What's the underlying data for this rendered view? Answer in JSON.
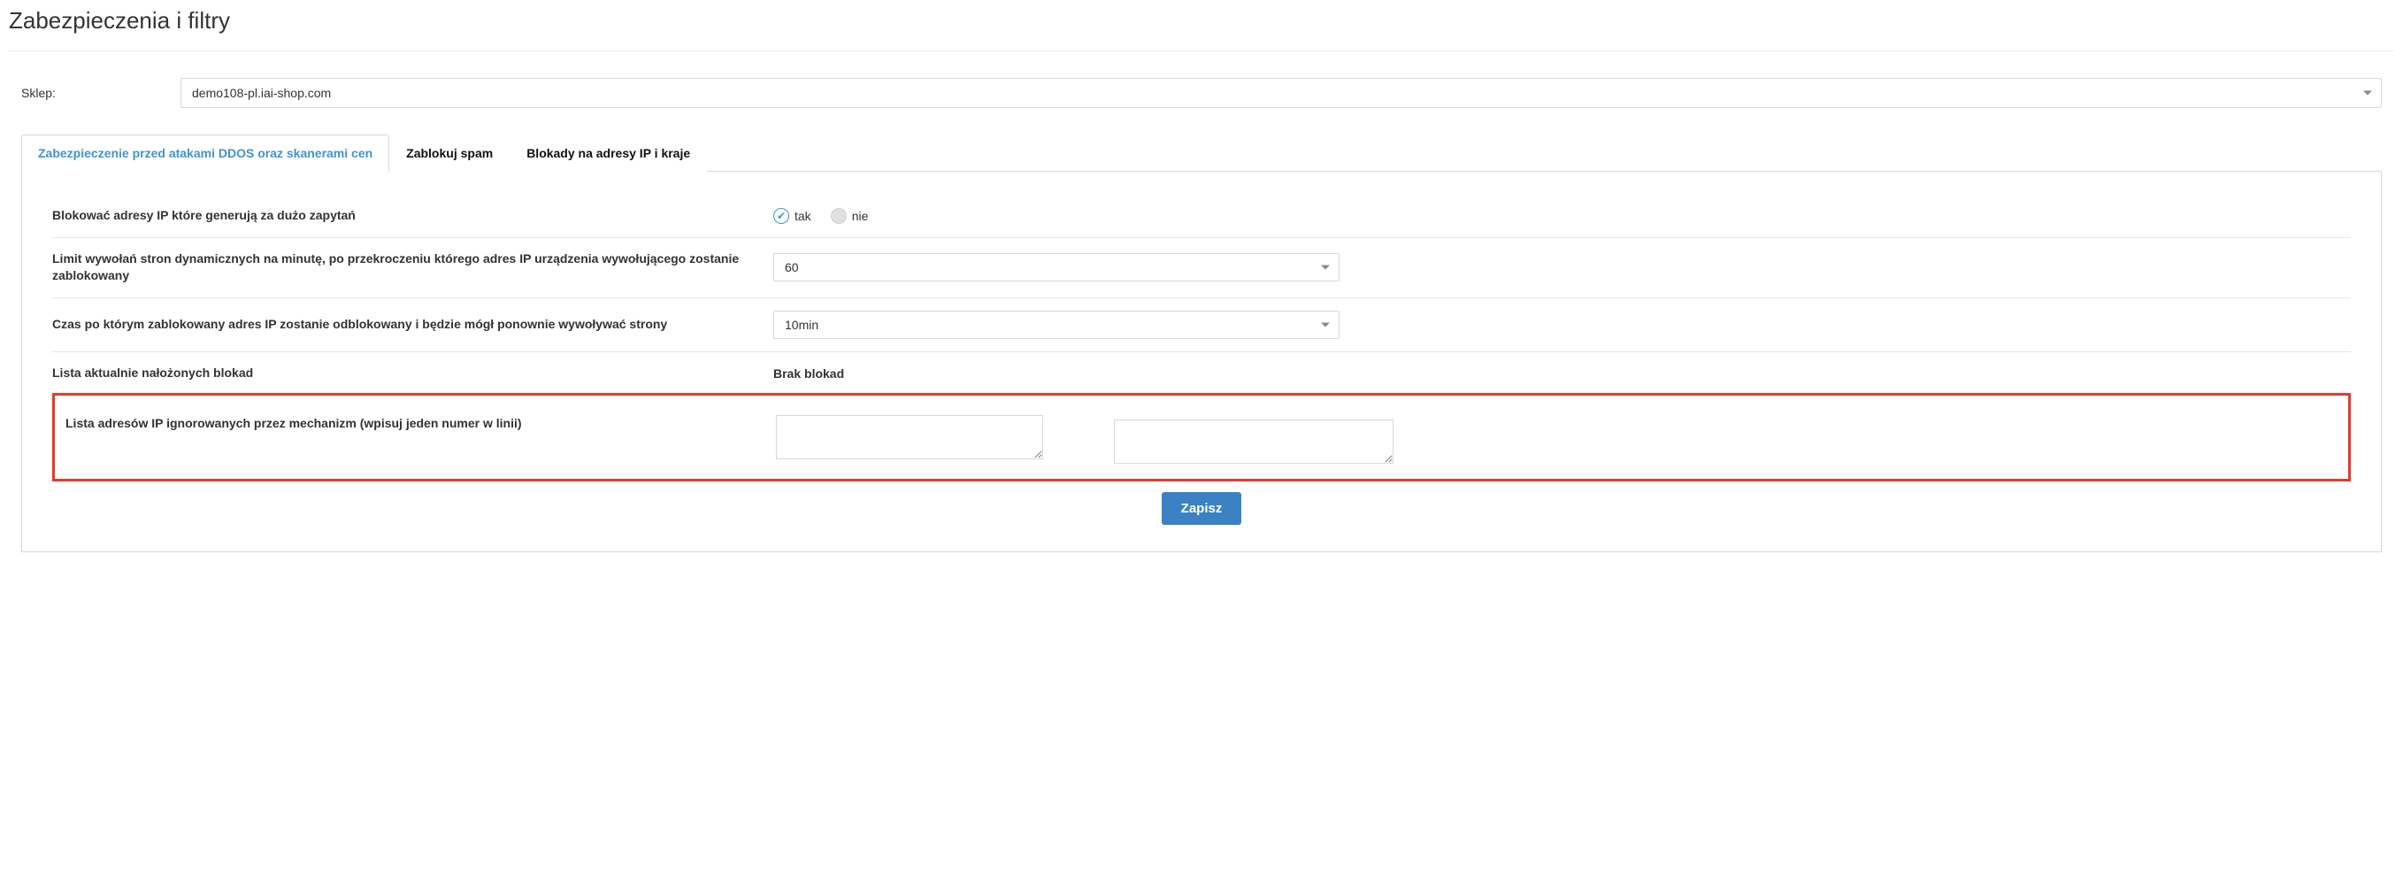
{
  "page": {
    "title": "Zabezpieczenia i filtry"
  },
  "shop": {
    "label": "Sklep:",
    "selected": "demo108-pl.iai-shop.com"
  },
  "tabs": {
    "ddos": "Zabezpieczenie przed atakami DDOS oraz skanerami cen",
    "spam": "Zablokuj spam",
    "ipblock": "Blokady na adresy IP i kraje"
  },
  "rows": {
    "block_ips": {
      "label": "Blokować adresy IP które generują za dużo zapytań",
      "yes": "tak",
      "no": "nie"
    },
    "limit": {
      "label": "Limit wywołań stron dynamicznych na minutę, po przekroczeniu którego adres IP urządzenia wywołującego zostanie zablokowany",
      "value": "60"
    },
    "unblock_time": {
      "label": "Czas po którym zablokowany adres IP zostanie odblokowany i będzie mógł ponownie wywoływać strony",
      "value": "10min"
    },
    "current_blocks": {
      "label": "Lista aktualnie nałożonych blokad",
      "value": "Brak blokad"
    },
    "ignored_ips": {
      "label": "Lista adresów IP ignorowanych przez mechanizm (wpisuj jeden numer w linii)",
      "value": ""
    }
  },
  "buttons": {
    "save": "Zapisz"
  }
}
